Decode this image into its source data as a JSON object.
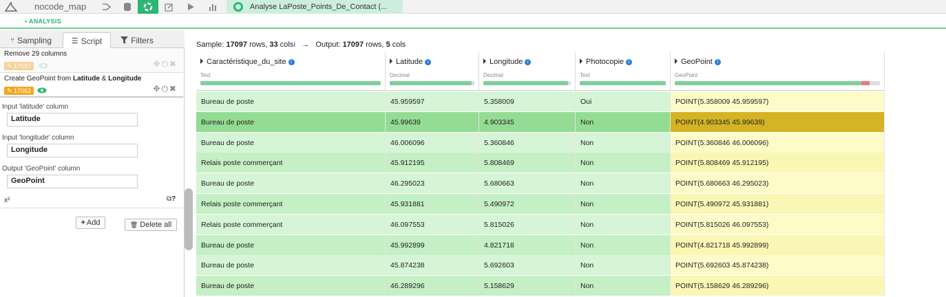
{
  "topbar": {
    "project": "nocode_map",
    "tab_title": "Analyse LaPoste_Points_De_Contact (..."
  },
  "subbar": {
    "crumb": "• ANALYSIS"
  },
  "left_tabs": [
    {
      "label": "Sampling",
      "icon": "sampling-icon"
    },
    {
      "label": "Script",
      "icon": "list-icon"
    },
    {
      "label": "Filters",
      "icon": "filter-icon"
    }
  ],
  "steps": [
    {
      "title": "Remove 29 columns",
      "badge": "17097"
    },
    {
      "title_pre": "Create GeoPoint from ",
      "title_b1": "Latitude",
      "title_mid": " & ",
      "title_b2": "Longitude",
      "badge": "17062"
    }
  ],
  "form": {
    "lat_label": "Input 'latitude' column",
    "lat_value": "Latitude",
    "lon_label": "Input 'longitude' column",
    "lon_value": "Longitude",
    "out_label": "Output 'GeoPoint' column",
    "out_value": "GeoPoint",
    "x2": "x²"
  },
  "buttons": {
    "add": "Add",
    "delete_all": "Delete all"
  },
  "summary": {
    "sample_label": "Sample: ",
    "sample_rows": "17097",
    "rows_word": " rows, ",
    "sample_cols": "33",
    "cols_word": " cols",
    "info": "i",
    "arrow": "→",
    "output_label": "Output: ",
    "output_rows": "17097",
    "output_cols": "5"
  },
  "columns": [
    {
      "name": "Caractéristique_du_site",
      "type": "Text",
      "fill": 1.0
    },
    {
      "name": "Latitude",
      "type": "Decimal",
      "fill": 0.97
    },
    {
      "name": "Longitude",
      "type": "Decimal",
      "fill": 0.97
    },
    {
      "name": "Photocopie",
      "type": "Text",
      "fill": 1.0
    },
    {
      "name": "GeoPoint",
      "type": "GeoPoint",
      "fill": 0.91,
      "invalid": 0.04
    }
  ],
  "rows": [
    [
      "Bureau de poste",
      "45.959597",
      "5.358009",
      "Oui",
      "POINT(5.358009 45.959597)"
    ],
    [
      "Bureau de poste",
      "45.99639",
      "4.903345",
      "Non",
      "POINT(4.903345 45.99639)"
    ],
    [
      "Bureau de poste",
      "46.006096",
      "5.360846",
      "Non",
      "POINT(5.360846 46.006096)"
    ],
    [
      "Relais poste commerçant",
      "45.912195",
      "5.808469",
      "Non",
      "POINT(5.808469 45.912195)"
    ],
    [
      "Bureau de poste",
      "46.295023",
      "5.680663",
      "Non",
      "POINT(5.680663 46.295023)"
    ],
    [
      "Relais poste commerçant",
      "45.931881",
      "5.490972",
      "Non",
      "POINT(5.490972 45.931881)"
    ],
    [
      "Relais poste commerçant",
      "46.097553",
      "5.815026",
      "Non",
      "POINT(5.815026 46.097553)"
    ],
    [
      "Bureau de poste",
      "45.992899",
      "4.821718",
      "Non",
      "POINT(4.821718 45.992899)"
    ],
    [
      "Bureau de poste",
      "45.874238",
      "5.692603",
      "Non",
      "POINT(5.692603 45.874238)"
    ],
    [
      "Bureau de poste",
      "46.289296",
      "5.158629",
      "Non",
      "POINT(5.158629 46.289296)"
    ]
  ],
  "selected_row": 1,
  "colors": {
    "accent": "#2bb673",
    "cell_even": "#d6f5d6",
    "cell_odd": "#c5efc5",
    "cell_selected": "#94dc94",
    "geo_even": "#fdfbc8",
    "geo_odd": "#faf6b4",
    "geo_selected": "#d4b424"
  }
}
